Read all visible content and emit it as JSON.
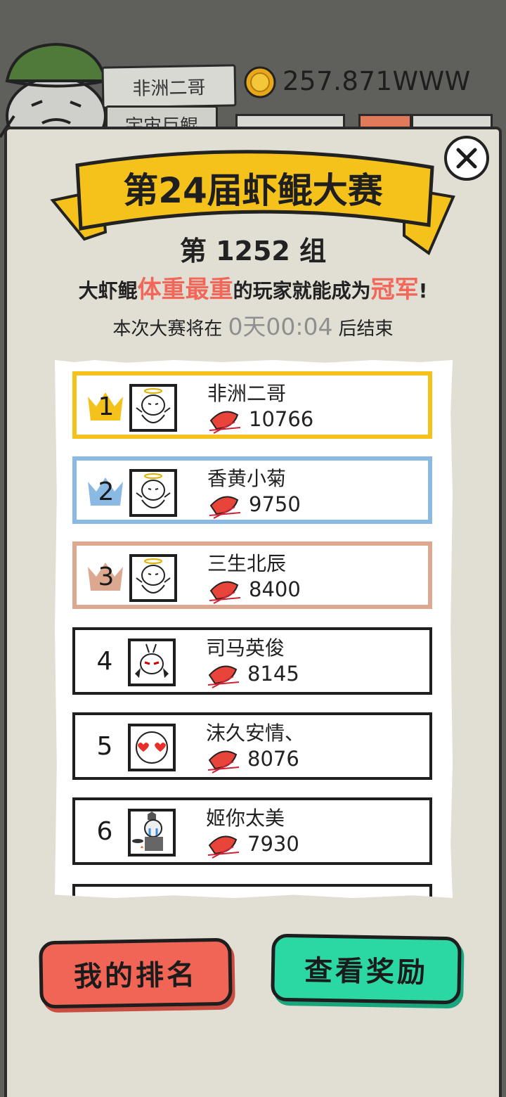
{
  "header": {
    "player_name": "非洲二哥",
    "player_title": "宇宙巨鲲",
    "coins": "257.871WWW"
  },
  "panel": {
    "contest_title": "第24届虾鲲大赛",
    "group_label": "第 1252 组",
    "rule": {
      "prefix": "大虾鲲",
      "highlight1": "体重最重",
      "middle": "的玩家就能成为",
      "highlight2": "冠军",
      "suffix": "!"
    },
    "timer": {
      "prefix": "本次大赛将在",
      "time": "0天00:04",
      "suffix": "后结束"
    }
  },
  "leaderboard": [
    {
      "rank": "1",
      "name": "非洲二哥",
      "score": "10766",
      "tier": "gold",
      "avatar": "angel-bear-avatar"
    },
    {
      "rank": "2",
      "name": "香黄小菊",
      "score": "9750",
      "tier": "silver",
      "avatar": "angel-bear-avatar"
    },
    {
      "rank": "3",
      "name": "三生北辰",
      "score": "8400",
      "tier": "bronze",
      "avatar": "angel-bear-avatar"
    },
    {
      "rank": "4",
      "name": "司马英俊",
      "score": "8145",
      "tier": "normal",
      "avatar": "devil-rabbit-avatar"
    },
    {
      "rank": "5",
      "name": "沫久安情、",
      "score": "8076",
      "tier": "normal",
      "avatar": "heart-eyes-avatar"
    },
    {
      "rank": "6",
      "name": "姬你太美",
      "score": "7930",
      "tier": "normal",
      "avatar": "crying-chef-avatar"
    }
  ],
  "buttons": {
    "my_rank": "我的排名",
    "view_rewards": "查看奖励"
  },
  "colors": {
    "gold": "#f5c21c",
    "silver": "#8ab9e3",
    "bronze": "#dda890",
    "highlight": "#f2675a",
    "my_rank_button": "#f06556",
    "reward_button": "#2bd8a4"
  }
}
